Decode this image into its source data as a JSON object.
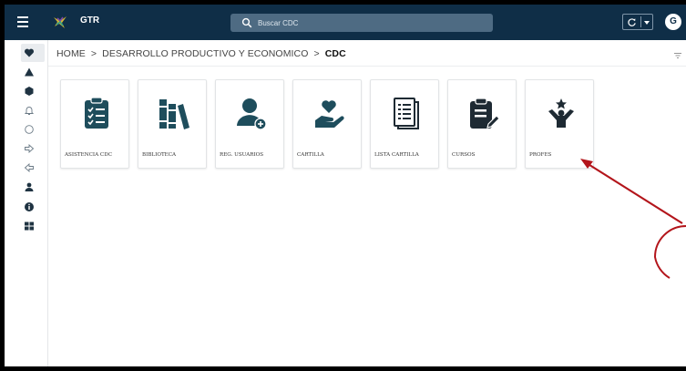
{
  "header": {
    "app_title": "GTR",
    "search_placeholder": "Buscar CDC",
    "avatar_initial": "G"
  },
  "sidebar": {
    "items": [
      {
        "icon": "heart-icon"
      },
      {
        "icon": "triangle-icon"
      },
      {
        "icon": "hexagon-icon"
      },
      {
        "icon": "bell-icon"
      },
      {
        "icon": "circle-icon"
      },
      {
        "icon": "arrow-right-icon"
      },
      {
        "icon": "arrow-left-icon"
      },
      {
        "icon": "user-icon"
      },
      {
        "icon": "info-icon"
      },
      {
        "icon": "grid-icon"
      }
    ]
  },
  "breadcrumb": {
    "items": [
      "HOME",
      "DESARROLLO PRODUCTIVO Y ECONOMICO",
      "CDC"
    ],
    "separator": ">"
  },
  "tiles": [
    {
      "label": "ASISTENCIA CDC",
      "icon": "clipboard-check-icon"
    },
    {
      "label": "BIBLIOTECA",
      "icon": "books-icon"
    },
    {
      "label": "REG. USUARIOS",
      "icon": "user-add-icon"
    },
    {
      "label": "CARTILLA",
      "icon": "hand-heart-icon"
    },
    {
      "label": "LISTA CARTILLA",
      "icon": "list-document-icon"
    },
    {
      "label": "CURSOS",
      "icon": "clipboard-edit-icon"
    },
    {
      "label": "PROFES",
      "icon": "person-star-icon"
    }
  ],
  "colors": {
    "topbar": "#0f2e47",
    "icon": "#1e4d5c",
    "annotation": "#b3151b"
  }
}
